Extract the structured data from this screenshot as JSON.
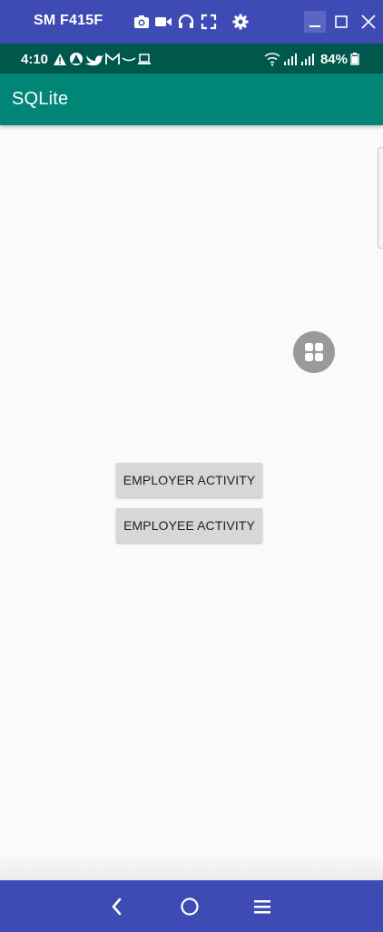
{
  "window": {
    "device_name": "SM F415F",
    "toolbar_icons": [
      "camera-icon",
      "video-icon",
      "headphones-icon",
      "fullscreen-icon",
      "settings-icon"
    ],
    "controls": [
      "minimize-icon",
      "maximize-icon",
      "close-icon"
    ]
  },
  "status_bar": {
    "time": "4:10",
    "notification_icons": [
      "alert-icon",
      "autopilot-icon",
      "twitter-icon",
      "gmail-icon",
      "link-icon",
      "laptop-icon"
    ],
    "battery": "84%",
    "signal_icons": [
      "wifi-icon",
      "signal-icon",
      "signal-icon",
      "battery-icon"
    ]
  },
  "app_bar": {
    "title": "SQLite"
  },
  "main": {
    "buttons": {
      "employer": "EMPLOYER ACTIVITY",
      "employee": "EMPLOYEE ACTIVITY"
    },
    "floating_launcher_icon": "grid-icon"
  },
  "nav_bar": {
    "buttons": [
      "back-icon",
      "home-icon",
      "recents-icon"
    ]
  },
  "colors": {
    "window_bar": "#3f4bb4",
    "status_bar": "#00574b",
    "app_bar": "#008577",
    "background": "#fafafa",
    "button": "#d6d7d7"
  }
}
